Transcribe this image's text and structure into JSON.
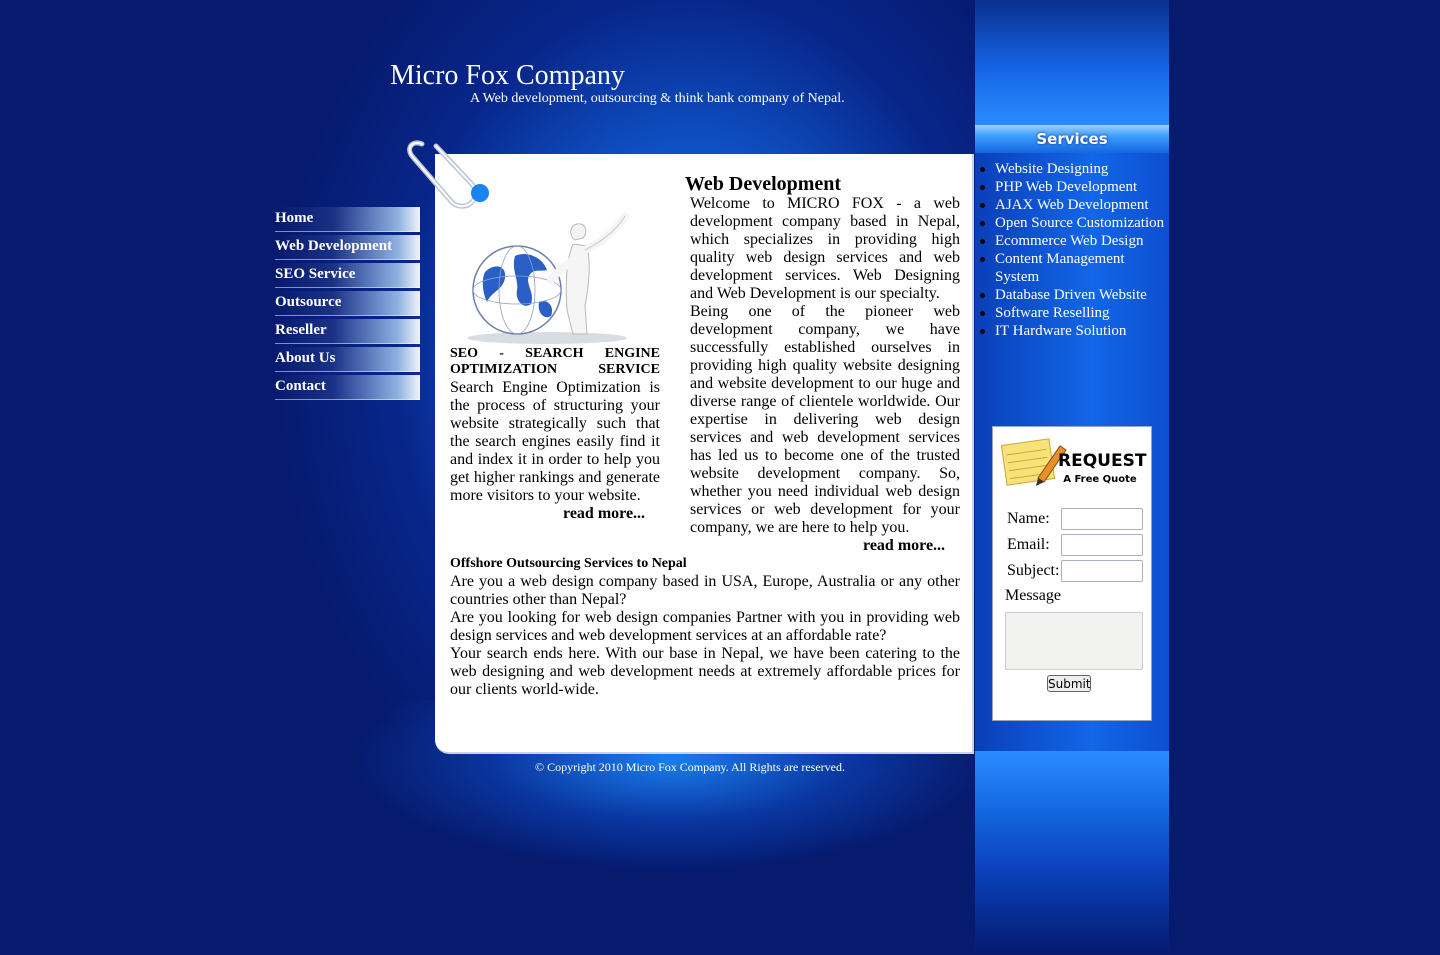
{
  "header": {
    "title": "Micro Fox Company",
    "tagline": "A Web development, outsourcing & think bank company of Nepal."
  },
  "nav": {
    "items": [
      "Home",
      "Web Development",
      "SEO Service",
      "Outsource",
      "Reseller",
      "About Us",
      "Contact"
    ]
  },
  "seo": {
    "heading_line1": "SEO - SEARCH ENGINE",
    "heading_line2": "OPTIMIZATION SERVICE",
    "body": "Search Engine Optimization is the process of structuring your website strategically such that the search engines easily find it and index it in order to help you get higher rankings and generate more visitors to your website.",
    "read_more": "read more..."
  },
  "web_dev": {
    "heading": "Web Development",
    "para1": "Welcome to MICRO FOX - a web development company based in Nepal, which specializes in providing high quality web design services and web development services. Web Designing and Web Development is our specialty.",
    "para2": "Being one of the pioneer web development company, we have successfully established ourselves in providing high quality website designing and website development to our huge and diverse range of clientele worldwide. Our expertise in delivering web design services and web development services has led us to become one of the trusted website development company. So, whether you need individual web design services or web development for your company, we are here to help you.",
    "read_more": "read more..."
  },
  "outsourcing": {
    "heading": "Offshore Outsourcing Services to Nepal",
    "para1": "Are you a web design company based in USA, Europe, Australia or any other countries other than Nepal?",
    "para2": "Are you looking for web design companies Partner with you in providing web design services and web development services at an affordable rate?",
    "para3": "Your search ends here. With our base in Nepal, we have been catering to the web designing and web development needs at extremely affordable prices for our clients world-wide."
  },
  "footer": {
    "copyright": "© Copyright 2010 Micro Fox Company. All Rights are reserved."
  },
  "services": {
    "heading": "Services",
    "items": [
      "Website Designing",
      "PHP Web Development",
      "AJAX Web Development",
      "Open Source Customization",
      "Ecommerce Web Design",
      "Content Management System",
      "Database Driven Website",
      "Software Reselling",
      "IT Hardware Solution"
    ]
  },
  "quote_form": {
    "logo_text_main": "REQUEST",
    "logo_text_sub": "A Free Quote",
    "name_label": "Name:",
    "email_label": "Email:",
    "subject_label": "Subject:",
    "message_label": "Message",
    "submit_label": "Submit"
  },
  "colors": {
    "background": "#061a6e",
    "glow": "#1e86ff",
    "panel": "#ffffff",
    "text_on_blue": "#ffffff"
  },
  "icons": [
    "paperclip-icon",
    "globe-person-illustration",
    "notepad-pencil-icon"
  ]
}
